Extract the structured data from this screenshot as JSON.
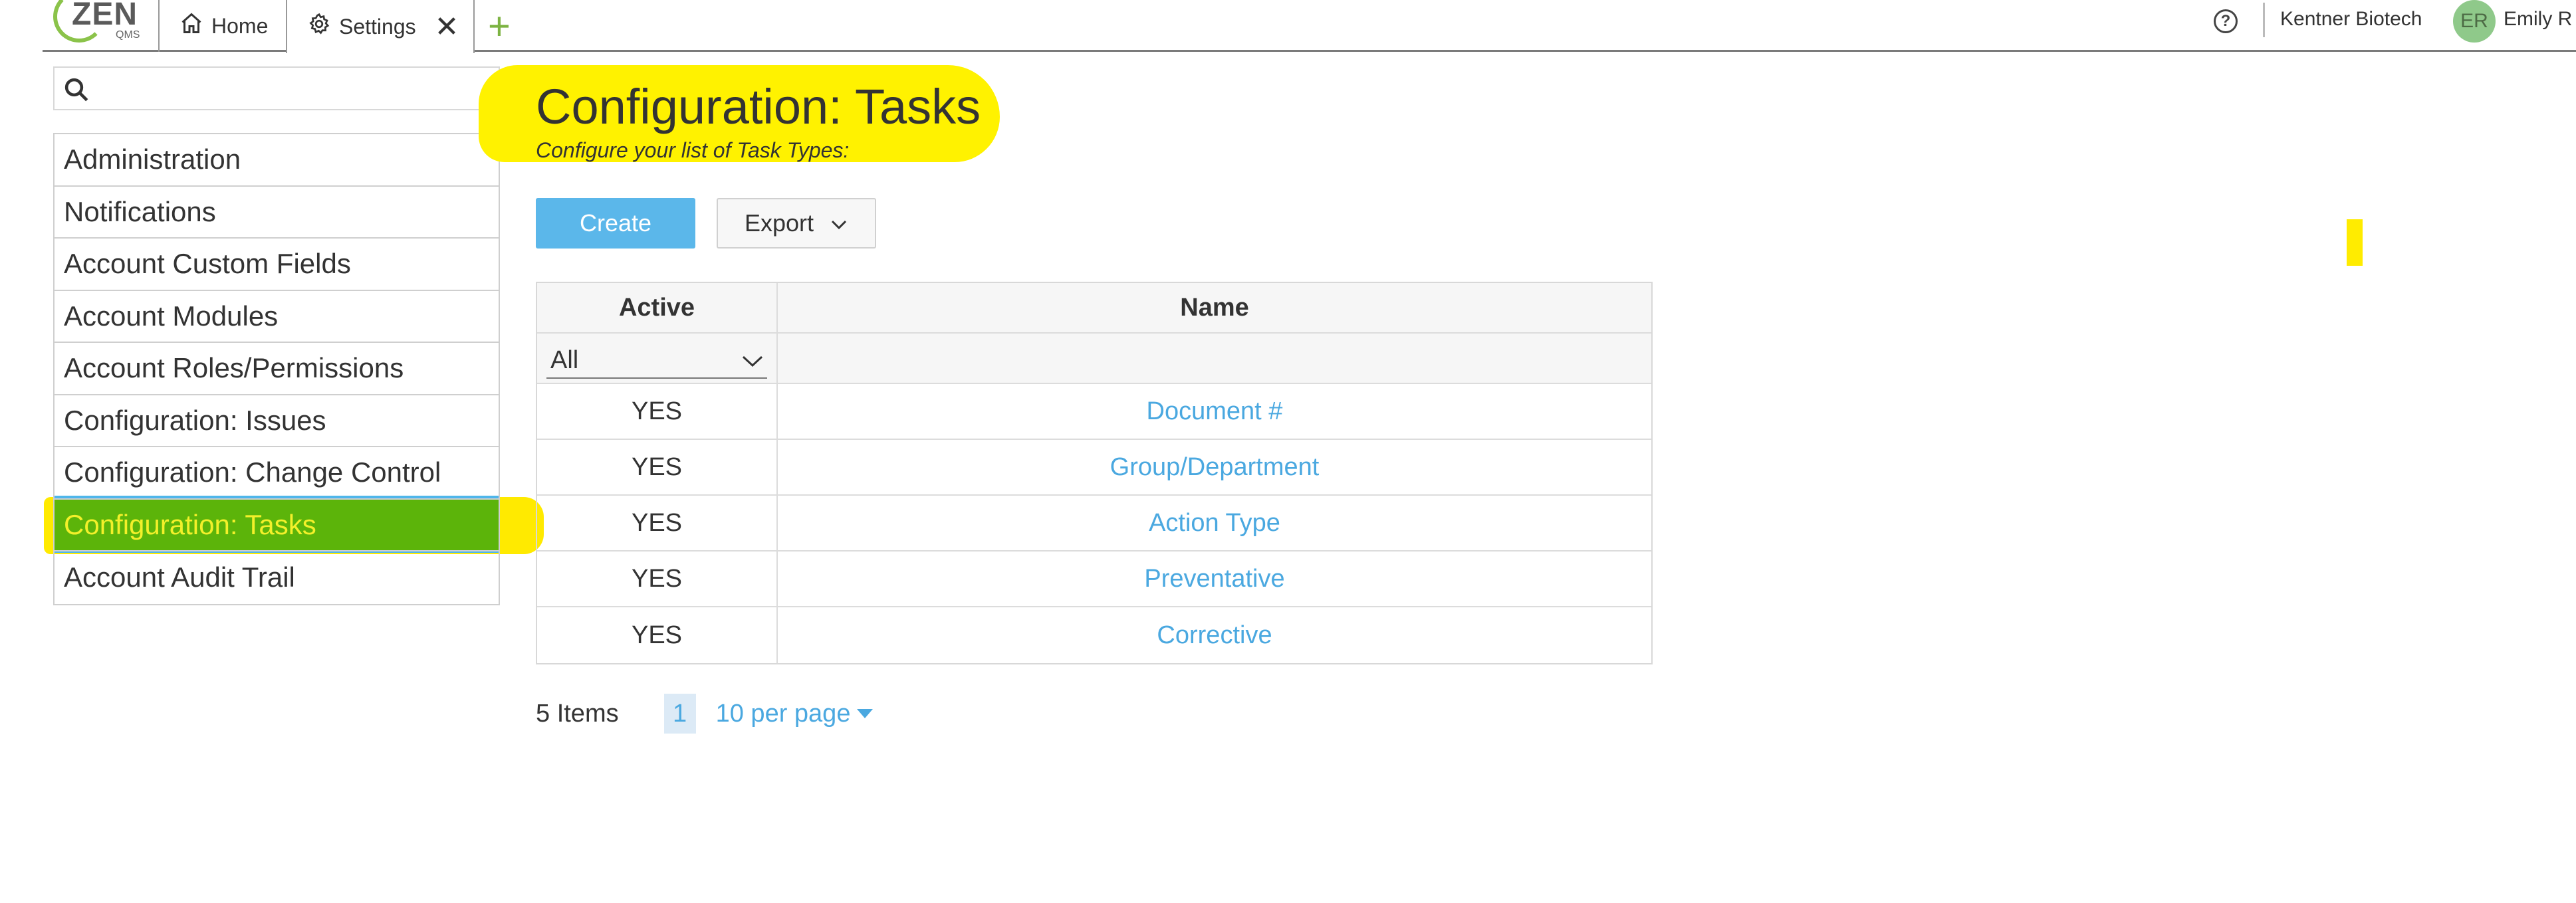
{
  "header": {
    "logo_text": "ZEN",
    "logo_sub": "QMS",
    "tabs": [
      {
        "label": "Home",
        "icon": "home-icon"
      },
      {
        "label": "Settings",
        "icon": "gear-icon",
        "closable": true
      }
    ],
    "add_tab_symbol": "+",
    "help_symbol": "?",
    "company": "Kentner Biotech",
    "user_initials": "ER",
    "user_name": "Emily R"
  },
  "sidebar": {
    "search_placeholder": "",
    "items": [
      {
        "label": "Administration"
      },
      {
        "label": "Notifications"
      },
      {
        "label": "Account Custom Fields"
      },
      {
        "label": "Account Modules"
      },
      {
        "label": "Account Roles/Permissions"
      },
      {
        "label": "Configuration: Issues"
      },
      {
        "label": "Configuration: Change Control"
      },
      {
        "label": "Configuration: Tasks",
        "active": true
      },
      {
        "label": "Account Audit Trail"
      }
    ]
  },
  "main": {
    "title": "Configuration: Tasks",
    "subtitle": "Configure your list of Task Types:",
    "create_label": "Create",
    "export_label": "Export",
    "table": {
      "columns": [
        "Active",
        "Name"
      ],
      "filter_active": "All",
      "rows": [
        {
          "active": "YES",
          "name": "Document #"
        },
        {
          "active": "YES",
          "name": "Group/Department"
        },
        {
          "active": "YES",
          "name": "Action Type"
        },
        {
          "active": "YES",
          "name": "Preventative"
        },
        {
          "active": "YES",
          "name": "Corrective"
        }
      ]
    },
    "pager": {
      "items_text": "5 Items",
      "current_page": "1",
      "per_page": "10 per page"
    }
  },
  "colors": {
    "accent_blue": "#5bb7ea",
    "link_blue": "#4aa8e0",
    "active_green": "#5cb40a",
    "highlight_yellow": "#fff200",
    "logo_green": "#8bc34a"
  }
}
